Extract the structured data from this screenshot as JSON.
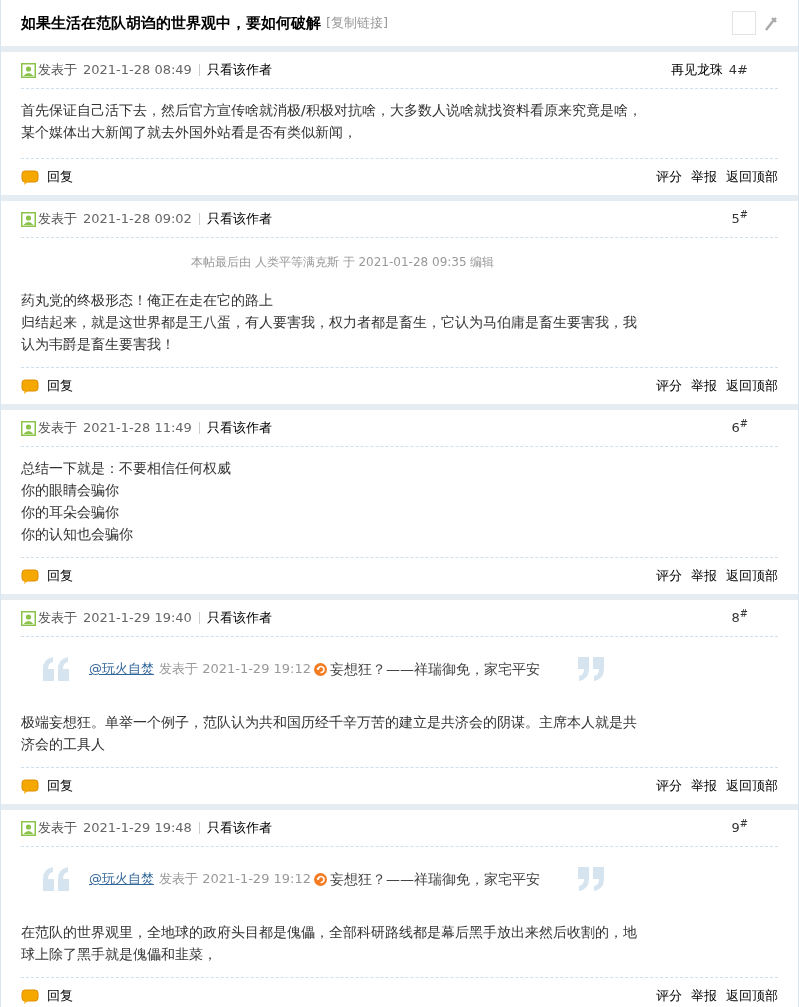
{
  "thread": {
    "title": "如果生活在范队胡诌的世界观中，要如何破解",
    "copy_link": "[复制链接]"
  },
  "posts": [
    {
      "posted_label": "发表于",
      "time": "2021-1-28 08:49",
      "only_author": "只看该作者",
      "author": "再见龙珠",
      "floor": "4#",
      "lines": [
        "首先保证自己活下去，然后官方宣传啥就消极/积极对抗啥，大多数人说啥就找资料看原来究竟是啥，某个媒体出大新闻了就去外国外站看是否有类似新闻，"
      ],
      "reply": "回复",
      "actions": [
        "评分",
        "举报",
        "返回顶部"
      ]
    },
    {
      "posted_label": "发表于",
      "time": "2021-1-28 09:02",
      "only_author": "只看该作者",
      "floor": "5$^{#}$",
      "edit_note": "本帖最后由 人类平等满克斯 于 2021-01-28 09:35 编辑",
      "lines": [
        "药丸党的终极形态！俺正在走在它的路上",
        "归结起来，就是这世界都是王八蛋，有人要害我，权力者都是畜生，它认为马伯庸是畜生要害我，我认为韦爵是畜生要害我！"
      ],
      "reply": "回复",
      "actions": [
        "评分",
        "举报",
        "返回顶部"
      ]
    },
    {
      "posted_label": "发表于",
      "time": "2021-1-28 11:49",
      "only_author": "只看该作者",
      "floor": "6$^{#}$",
      "lines": [
        "总结一下就是：不要相信任何权威",
        "你的眼睛会骗你",
        "你的耳朵会骗你",
        "你的认知也会骗你"
      ],
      "reply": "回复",
      "actions": [
        "评分",
        "举报",
        "返回顶部"
      ]
    },
    {
      "posted_label": "发表于",
      "time": "2021-1-29 19:40",
      "only_author": "只看该作者",
      "floor": "8$^{#}$",
      "quote": {
        "user": "@玩火自焚",
        "posted": "发表于 2021-1-29 19:12",
        "text": "妄想狂？——祥瑞御免，家宅平安"
      },
      "lines": [
        "极端妄想狂。单举一个例子，范队认为共和国历经千辛万苦的建立是共济会的阴谋。主席本人就是共济会的工具人"
      ],
      "reply": "回复",
      "actions": [
        "评分",
        "举报",
        "返回顶部"
      ]
    },
    {
      "posted_label": "发表于",
      "time": "2021-1-29 19:48",
      "only_author": "只看该作者",
      "floor": "9$^{#}$",
      "quote": {
        "user": "@玩火自焚",
        "posted": "发表于 2021-1-29 19:12",
        "text": "妄想狂？——祥瑞御免，家宅平安"
      },
      "lines": [
        "在范队的世界观里，全地球的政府头目都是傀儡，全部科研路线都是幕后黑手放出来然后收割的，地球上除了黑手就是傀儡和韭菜，"
      ],
      "reply": "回复",
      "actions": [
        "评分",
        "举报",
        "返回顶部"
      ]
    }
  ]
}
